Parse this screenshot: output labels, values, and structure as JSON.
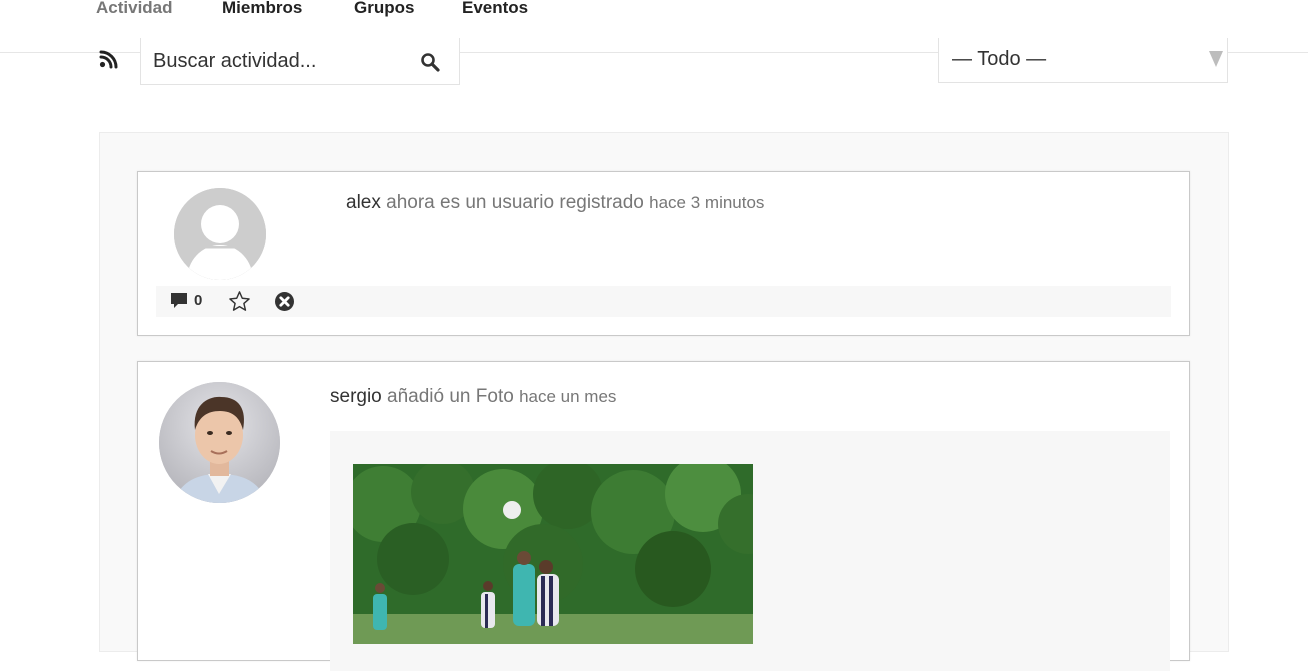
{
  "nav": {
    "tabs": [
      {
        "label": "Actividad",
        "active": true
      },
      {
        "label": "Miembros",
        "active": false
      },
      {
        "label": "Grupos",
        "active": false
      },
      {
        "label": "Eventos",
        "active": false
      }
    ]
  },
  "toolbar": {
    "rss_icon": "rss-icon",
    "search": {
      "placeholder": "Buscar actividad...",
      "value": "",
      "icon": "search-icon"
    },
    "filter": {
      "selected": "— Todo —",
      "icon": "chevron-down-icon"
    }
  },
  "activities": [
    {
      "user": "alex",
      "action": "ahora es un usuario registrado",
      "time": "hace 3 minutos",
      "avatar": "default-avatar",
      "comment_count": "0",
      "icons": [
        "comment-icon",
        "star-icon",
        "delete-icon"
      ]
    },
    {
      "user": "sergio",
      "action": "añadió un Foto",
      "time": "hace un mes",
      "avatar": "user-photo",
      "media": "soccer-photo"
    }
  ],
  "colors": {
    "text": "#333333",
    "muted": "#777777",
    "border": "#c9c9c9",
    "stream_bg": "#f9f9f9"
  }
}
